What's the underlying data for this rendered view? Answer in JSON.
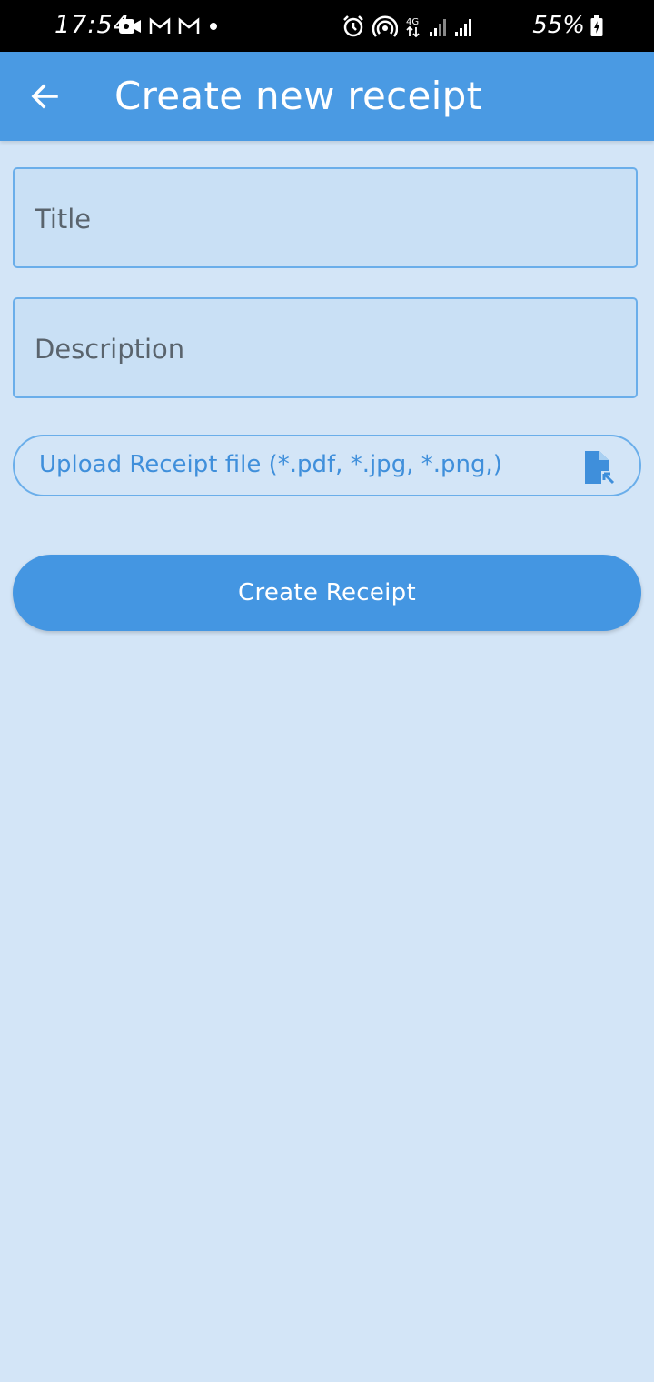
{
  "status_bar": {
    "time": "17:54",
    "battery": "55%",
    "network": "4G",
    "icons": [
      "video-icon",
      "gmail-icon",
      "gmail-icon",
      "dot-icon",
      "alarm-icon",
      "hotspot-icon",
      "signal-icon",
      "signal-icon",
      "battery-charging-icon"
    ]
  },
  "app_bar": {
    "title": "Create new receipt",
    "back_icon": "arrow-left-icon"
  },
  "form": {
    "title_placeholder": "Title",
    "description_placeholder": "Description",
    "upload_label": "Upload Receipt file (*.pdf, *.jpg, *.png,)",
    "upload_icon": "file-upload-icon",
    "submit_label": "Create Receipt"
  },
  "colors": {
    "app_bar": "#4a9ae3",
    "background": "#d3e5f7",
    "field_fill": "#c9e0f5",
    "field_border": "#6aaeea",
    "accent": "#4496e2",
    "accent_text": "#3f8fdb"
  }
}
